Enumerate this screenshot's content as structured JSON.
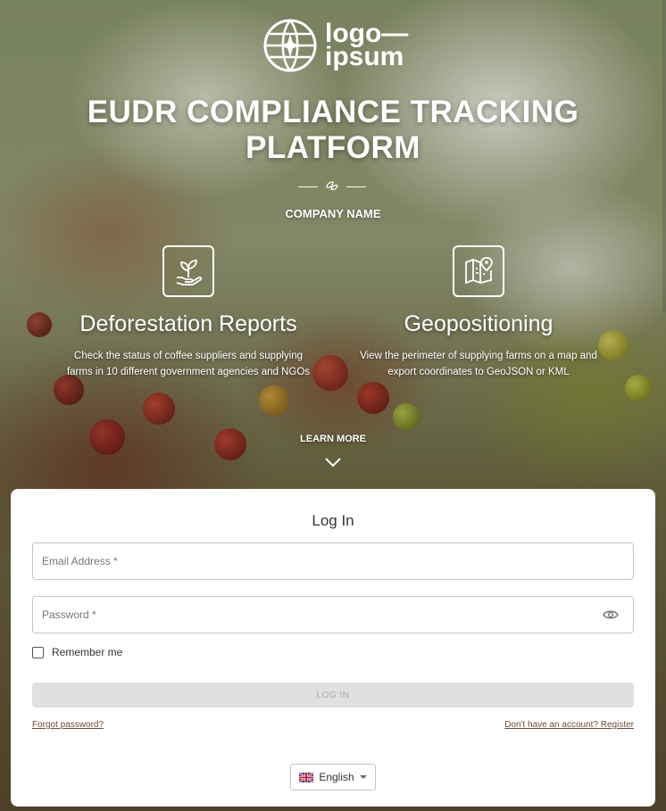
{
  "brand": {
    "logo_line1": "logo—",
    "logo_line2": "ipsum"
  },
  "hero": {
    "title": "EUDR COMPLIANCE TRACKING PLATFORM",
    "company": "COMPANY NAME",
    "features": [
      {
        "icon": "plant-in-hand-icon",
        "title": "Deforestation Reports",
        "description": "Check the status of coffee suppliers and supplying farms in 10 different government agencies and NGOs"
      },
      {
        "icon": "map-location-icon",
        "title": "Geopositioning",
        "description": "View the perimeter of supplying farms on a map and export coordinates to GeoJSON or KML"
      }
    ],
    "learn_more": "LEARN MORE"
  },
  "login": {
    "title": "Log In",
    "email_placeholder": "Email Address *",
    "password_placeholder": "Password *",
    "remember_label": "Remember me",
    "submit_label": "LOG IN",
    "forgot_label": "Forgot password?",
    "register_label": "Don't have an account? Register",
    "language": "English"
  },
  "colors": {
    "card_bg": "#ffffff",
    "button_disabled": "#e0e0e0",
    "link": "#6d4c3b"
  }
}
